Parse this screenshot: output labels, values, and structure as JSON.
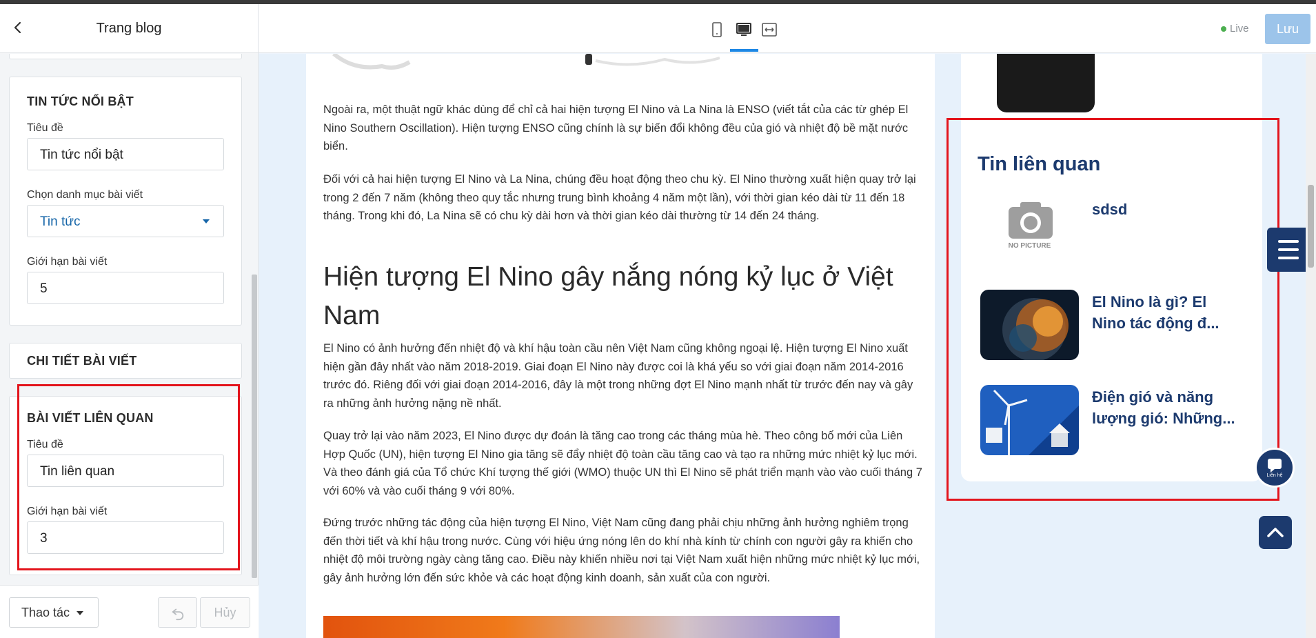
{
  "left_panel": {
    "title": "Trang blog",
    "featured": {
      "heading": "TIN TỨC NỔI BẬT",
      "title_label": "Tiêu đề",
      "title_value": "Tin tức nổi bật",
      "category_label": "Chọn danh mục bài viết",
      "category_value": "Tin tức",
      "limit_label": "Giới hạn bài viết",
      "limit_value": "5"
    },
    "detail": {
      "heading": "CHI TIẾT BÀI VIẾT"
    },
    "related": {
      "heading": "BÀI VIẾT LIÊN QUAN",
      "title_label": "Tiêu đề",
      "title_value": "Tin liên quan",
      "limit_label": "Giới hạn bài viết",
      "limit_value": "3"
    },
    "footer": {
      "action_label": "Thao tác",
      "cancel_label": "Hủy"
    }
  },
  "topbar": {
    "devices": [
      "mobile-icon",
      "desktop-icon",
      "fullwidth-icon"
    ],
    "live_label": "Live",
    "save_label": "Lưu",
    "accent": "#1e88e5"
  },
  "article": {
    "paragraphs_top": [
      "Ngoài ra, một thuật ngữ khác dùng để chỉ cả hai hiện tượng El Nino và La Nina là ENSO (viết tắt của các từ ghép El Nino Southern Oscillation). Hiện tượng ENSO cũng chính là sự biến đổi không đều của gió và nhiệt độ bề mặt nước biển.",
      "Đối với cả hai hiện tượng El Nino và La Nina, chúng đều hoạt động theo chu kỳ. El Nino thường xuất hiện quay trở lại trong 2 đến 7 năm (không theo quy tắc nhưng trung bình khoảng 4 năm một lần), với thời gian kéo dài từ 11 đến 18 tháng. Trong khi đó, La Nina sẽ có chu kỳ dài hơn và thời gian kéo dài thường từ 14 đến 24 tháng."
    ],
    "heading": "Hiện tượng El Nino gây nắng nóng kỷ lục ở Việt Nam",
    "paragraphs_bottom": [
      "El Nino có ảnh hưởng đến nhiệt độ và khí hậu toàn cầu nên Việt Nam cũng không ngoại lệ. Hiện tượng El Nino xuất hiện gần đây nhất vào năm 2018-2019. Giai đoạn El Nino này được coi là khá yếu so với giai đoạn năm 2014-2016 trước đó. Riêng đối với giai đoạn 2014-2016, đây là một trong những đợt El Nino mạnh nhất từ trước đến nay và gây ra những ảnh hưởng nặng nề nhất.",
      "Quay trở lại vào năm 2023, El Nino được dự đoán là tăng cao trong các tháng mùa hè. Theo công bố mới của Liên Hợp Quốc (UN), hiện tượng El Nino gia tăng sẽ đẩy nhiệt độ toàn cầu tăng cao và tạo ra những mức nhiệt kỷ lục mới. Và theo đánh giá của Tổ chức Khí tượng thế giới (WMO) thuộc UN thì El Nino sẽ phát triển mạnh vào vào cuối tháng 7 với 60% và vào cuối tháng 9 với 80%.",
      "Đứng trước những tác động của hiện tượng El Nino, Việt Nam cũng đang phải chịu những ảnh hưởng nghiêm trọng đến thời tiết và khí hậu trong nước. Cùng với hiệu ứng nóng lên do khí nhà kính từ chính con người gây ra khiến cho nhiệt độ môi trường ngày càng tăng cao. Điều này khiến nhiều nơi tại Việt Nam xuất hiện những mức nhiệt kỷ lục mới, gây ảnh hưởng lớn đến sức khỏe và các hoạt động kinh doanh, sản xuất của con người."
    ]
  },
  "sidebar": {
    "related_title": "Tin liên quan",
    "no_picture_label": "NO PICTURE",
    "items": [
      {
        "title": "sdsd"
      },
      {
        "title": "El Nino là gì? El Nino tác động đ..."
      },
      {
        "title": "Điện gió và năng lượng gió: Những..."
      }
    ],
    "contact_label": "Liên hệ",
    "brand_color": "#1c3a6e"
  }
}
